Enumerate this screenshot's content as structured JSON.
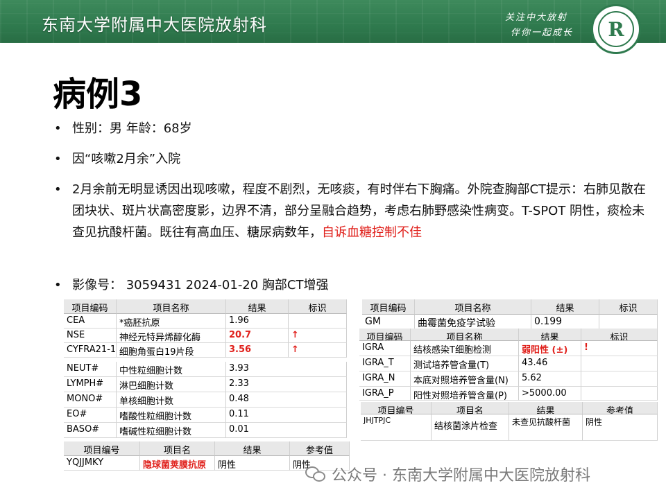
{
  "header": {
    "title": "东南大学附属中大医院放射科",
    "slogan_line1": "关注中大放射",
    "slogan_line2": "伴你一起成长",
    "logo_letter": "R"
  },
  "case_title": "病例3",
  "bullets": [
    {
      "text": "性别：男  年龄：68岁"
    },
    {
      "text": "因“咳嗽2月余”入院"
    },
    {
      "text": "2月余前无明显诱因出现咳嗽，程度不剧烈，无咳痰，有时伴右下胸痛。外院查胸部CT提示：右肺见散在团块状、斑片状高密度影，边界不清，部分呈融合趋势，考虑右肺野感染性病变。T-SPOT 阴性，痰检未查见抗酸杆菌。既往有高血压、糖尿病数年，",
      "highlight": "自诉血糖控制不佳"
    },
    {
      "text": "影像号： 3059431    2024-01-20   胸部CT增强"
    }
  ],
  "table_tumor": {
    "headers": [
      "项目编码",
      "项目名称",
      "结果",
      "标识"
    ],
    "rows": [
      {
        "code": "CEA",
        "name": "*癌胚抗原",
        "result": "1.96",
        "flag": ""
      },
      {
        "code": "NSE",
        "name": "神经元特异烯醇化酶",
        "result": "20.7",
        "flag": "↑"
      },
      {
        "code": "CYFRA21-1",
        "name": "细胞角蛋白19片段",
        "result": "3.56",
        "flag": "↑"
      }
    ]
  },
  "table_blood": {
    "rows": [
      {
        "code": "NEUT#",
        "name": "中性粒细胞计数",
        "result": "3.93"
      },
      {
        "code": "LYMPH#",
        "name": "淋巴细胞计数",
        "result": "2.33"
      },
      {
        "code": "MONO#",
        "name": "单核细胞计数",
        "result": "0.48"
      },
      {
        "code": "EO#",
        "name": "嗜酸性粒细胞计数",
        "result": "0.11"
      },
      {
        "code": "BASO#",
        "name": "嗜碱性粒细胞计数",
        "result": "0.01"
      }
    ]
  },
  "table_crypto": {
    "headers": [
      "项目编号",
      "项目名",
      "结果",
      "参考值"
    ],
    "rows": [
      {
        "code": "YQJJMKY",
        "name": "隐球菌荚膜抗原",
        "result": "阴性",
        "ref": "阴性"
      }
    ]
  },
  "table_gm": {
    "headers": [
      "项目编码",
      "项目名称",
      "结果",
      "标识"
    ],
    "rows": [
      {
        "code": "GM",
        "name": "曲霉菌免疫学试验",
        "result": "0.199",
        "flag": ""
      }
    ]
  },
  "table_igra": {
    "headers": [
      "项目编码",
      "项目名称",
      "结果",
      "标识"
    ],
    "rows": [
      {
        "code": "IGRA",
        "name": "结核感染T细胞检测",
        "result": "弱阳性 (±)",
        "flag": "!"
      },
      {
        "code": "IGRA_T",
        "name": "测试培养管含量(T)",
        "result": "43.46",
        "flag": ""
      },
      {
        "code": "IGRA_N",
        "name": "本底对照培养管含量(N)",
        "result": "5.62",
        "flag": ""
      },
      {
        "code": "IGRA_P",
        "name": "阳性对照培养管含量(P)",
        "result": ">5000.00",
        "flag": ""
      }
    ]
  },
  "table_smear": {
    "headers": [
      "项目编号",
      "项目名",
      "结果",
      "参考值"
    ],
    "rows": [
      {
        "code": "JHJTPJC",
        "name": "结核菌涂片检查",
        "result": "未查见抗酸杆菌",
        "ref": "阴性"
      }
    ]
  },
  "watermark": "公众号 · 东南大学附属中大医院放射科",
  "colors": {
    "banner": "#2f7a4e",
    "highlight": "#e0201b"
  }
}
